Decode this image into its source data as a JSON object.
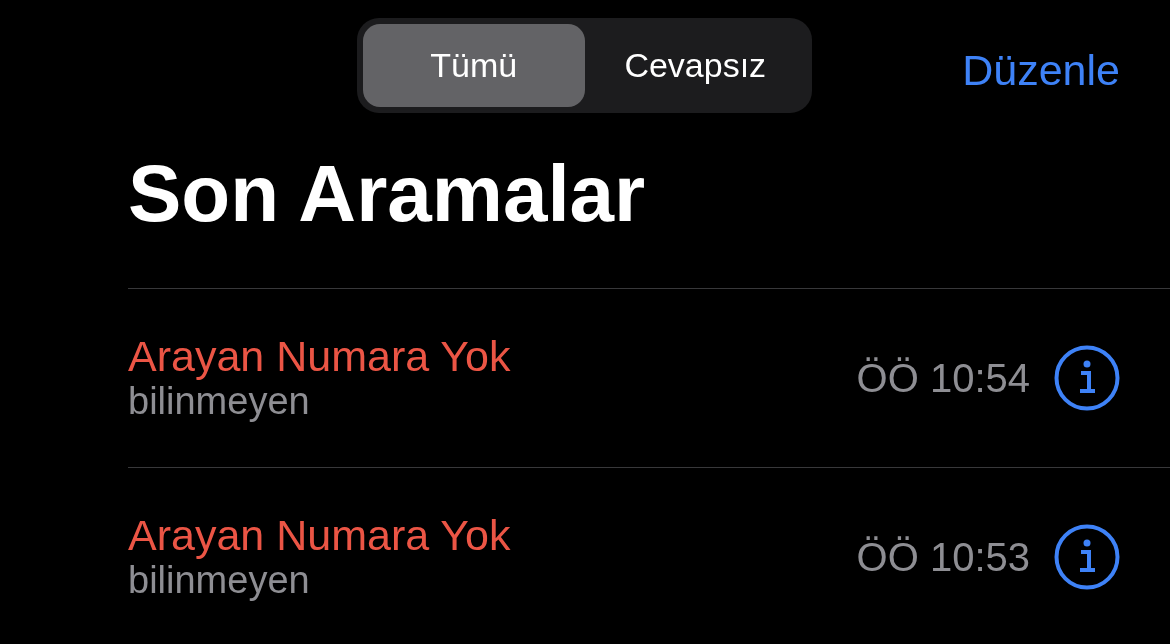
{
  "segments": [
    {
      "label": "Tümü",
      "selected": true
    },
    {
      "label": "Cevapsız",
      "selected": false
    }
  ],
  "edit_button": "Düzenle",
  "title": "Son Aramalar",
  "calls": [
    {
      "name": "Arayan Numara Yok",
      "missed": true,
      "subtitle": "bilinmeyen",
      "time": "ÖÖ 10:54"
    },
    {
      "name": "Arayan Numara Yok",
      "missed": true,
      "subtitle": "bilinmeyen",
      "time": "ÖÖ 10:53"
    }
  ]
}
